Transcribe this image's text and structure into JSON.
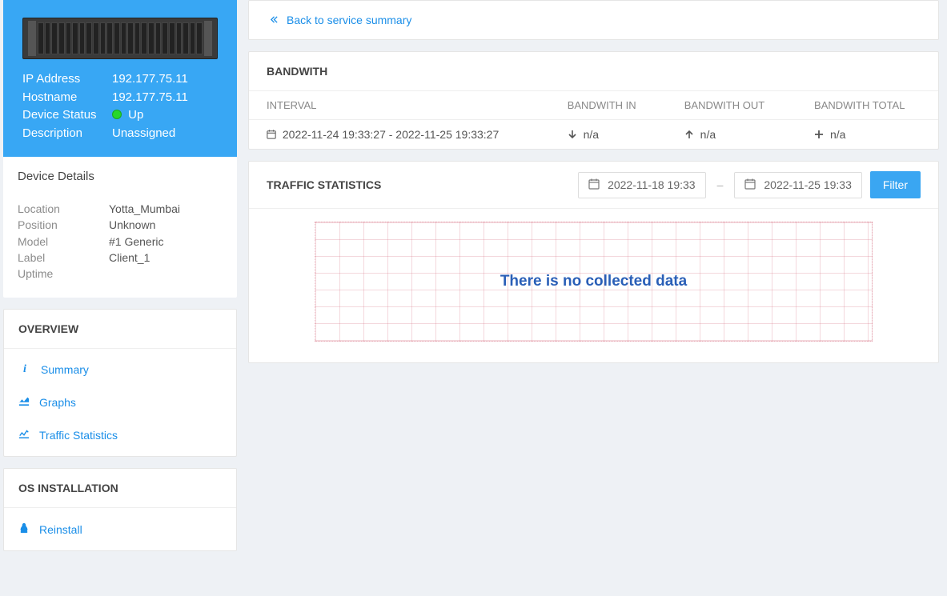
{
  "device": {
    "ip_label": "IP Address",
    "ip_value": "192.177.75.11",
    "hostname_label": "Hostname",
    "hostname_value": "192.177.75.11",
    "status_label": "Device Status",
    "status_value": "Up",
    "desc_label": "Description",
    "desc_value": "Unassigned"
  },
  "details": {
    "title": "Device Details",
    "location_label": "Location",
    "location_value": "Yotta_Mumbai",
    "position_label": "Position",
    "position_value": "Unknown",
    "model_label": "Model",
    "model_value": "#1 Generic",
    "label_label": "Label",
    "label_value": "Client_1",
    "uptime_label": "Uptime",
    "uptime_value": ""
  },
  "overview": {
    "title": "OVERVIEW",
    "summary": "Summary",
    "graphs": "Graphs",
    "traffic": "Traffic Statistics"
  },
  "osinstall": {
    "title": "OS INSTALLATION",
    "reinstall": "Reinstall"
  },
  "backlink": "Back to service summary",
  "bandwidth": {
    "title": "BANDWITH",
    "col_interval": "INTERVAL",
    "col_in": "BANDWITH IN",
    "col_out": "BANDWITH OUT",
    "col_total": "BANDWITH TOTAL",
    "row": {
      "interval": "2022-11-24 19:33:27 - 2022-11-25 19:33:27",
      "in": "n/a",
      "out": "n/a",
      "total": "n/a"
    }
  },
  "traffic": {
    "title": "TRAFFIC STATISTICS",
    "from": "2022-11-18 19:33",
    "to": "2022-11-25 19:33",
    "filter_btn": "Filter",
    "empty_msg": "There is no collected data"
  },
  "chart_data": {
    "type": "line",
    "series": [],
    "title": "Traffic Statistics",
    "xlabel": "",
    "ylabel": "",
    "empty": true
  }
}
